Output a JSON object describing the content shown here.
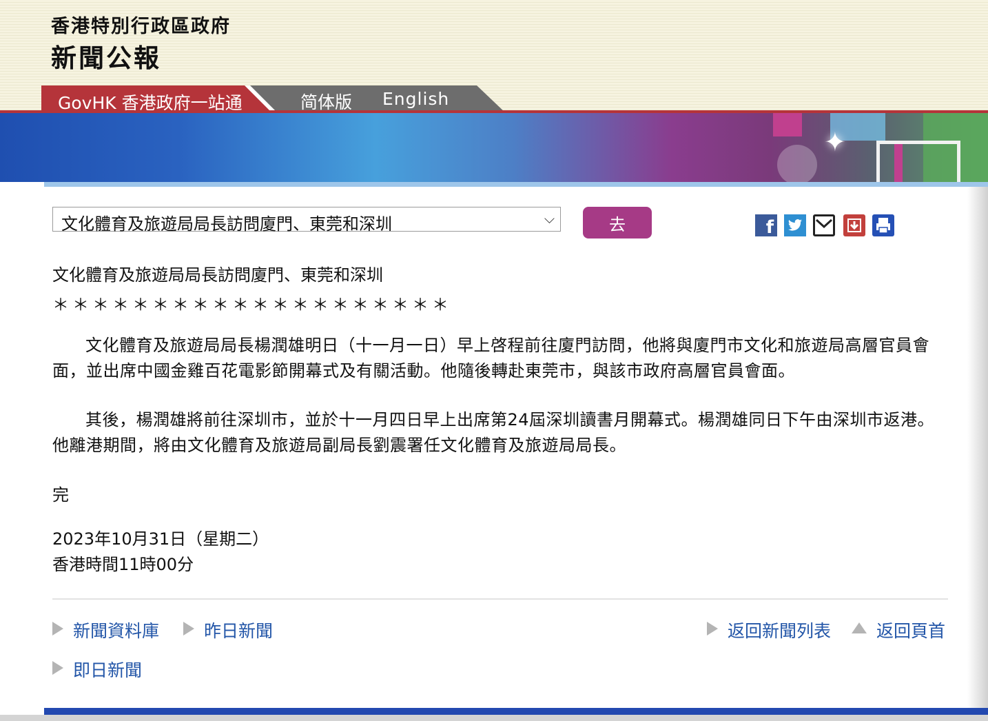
{
  "header": {
    "site_title": "香港特別行政區政府",
    "site_subtitle": "新聞公報",
    "nav": {
      "govhk": "GovHK 香港政府一站通",
      "simplified": "简体版",
      "english": "English"
    }
  },
  "selector": {
    "selected": "文化體育及旅遊局局長訪問廈門、東莞和深圳",
    "go_label": "去"
  },
  "share_icons": [
    "facebook-icon",
    "twitter-icon",
    "email-icon",
    "download-icon",
    "print-icon"
  ],
  "article": {
    "title": "文化體育及旅遊局局長訪問廈門、東莞和深圳",
    "stars": "＊＊＊＊＊＊＊＊＊＊＊＊＊＊＊＊＊＊＊＊",
    "paragraph1": "文化體育及旅遊局局長楊潤雄明日（十一月一日）早上啓程前往廈門訪問，他將與廈門市文化和旅遊局高層官員會面，並出席中國金雞百花電影節開幕式及有關活動。他隨後轉赴東莞市，與該市政府高層官員會面。",
    "paragraph2": "其後，楊潤雄將前往深圳市，並於十一月四日早上出席第24屆深圳讀書月開幕式。楊潤雄同日下午由深圳市返港。他離港期間，將由文化體育及旅遊局副局長劉震署任文化體育及旅遊局局長。",
    "end": "完",
    "date": "2023年10月31日（星期二）",
    "time": "香港時間11時00分"
  },
  "footer_links": {
    "archive": "新聞資料庫",
    "yesterday": "昨日新聞",
    "today": "即日新聞",
    "back_list": "返回新聞列表",
    "back_top": "返回頁首"
  },
  "colors": {
    "accent_red": "#b5343a",
    "go_button": "#a63a86",
    "link_blue": "#2356a8"
  }
}
